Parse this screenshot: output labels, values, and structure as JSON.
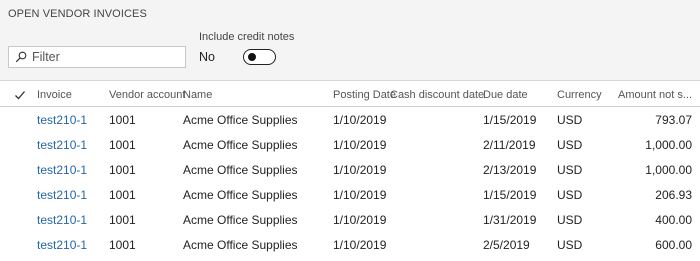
{
  "section": {
    "title": "OPEN VENDOR INVOICES"
  },
  "filter": {
    "placeholder": "Filter"
  },
  "credit_toggle": {
    "label": "Include credit notes",
    "value_text": "No"
  },
  "table": {
    "headers": {
      "invoice": "Invoice",
      "vendor_account": "Vendor account",
      "name": "Name",
      "posting_date": "Posting Date",
      "cash_discount_date": "Cash discount date",
      "due_date": "Due date",
      "currency": "Currency",
      "amount_not_settled": "Amount not s..."
    },
    "rows": [
      {
        "invoice": "test210-1",
        "vendor_account": "1001",
        "name": "Acme Office Supplies",
        "posting_date": "1/10/2019",
        "cash_discount_date": "",
        "due_date": "1/15/2019",
        "currency": "USD",
        "amount": "793.07"
      },
      {
        "invoice": "test210-1",
        "vendor_account": "1001",
        "name": "Acme Office Supplies",
        "posting_date": "1/10/2019",
        "cash_discount_date": "",
        "due_date": "2/11/2019",
        "currency": "USD",
        "amount": "1,000.00"
      },
      {
        "invoice": "test210-1",
        "vendor_account": "1001",
        "name": "Acme Office Supplies",
        "posting_date": "1/10/2019",
        "cash_discount_date": "",
        "due_date": "2/13/2019",
        "currency": "USD",
        "amount": "1,000.00"
      },
      {
        "invoice": "test210-1",
        "vendor_account": "1001",
        "name": "Acme Office Supplies",
        "posting_date": "1/10/2019",
        "cash_discount_date": "",
        "due_date": "1/15/2019",
        "currency": "USD",
        "amount": "206.93"
      },
      {
        "invoice": "test210-1",
        "vendor_account": "1001",
        "name": "Acme Office Supplies",
        "posting_date": "1/10/2019",
        "cash_discount_date": "",
        "due_date": "1/31/2019",
        "currency": "USD",
        "amount": "400.00"
      },
      {
        "invoice": "test210-1",
        "vendor_account": "1001",
        "name": "Acme Office Supplies",
        "posting_date": "1/10/2019",
        "cash_discount_date": "",
        "due_date": "2/5/2019",
        "currency": "USD",
        "amount": "600.00"
      }
    ]
  }
}
